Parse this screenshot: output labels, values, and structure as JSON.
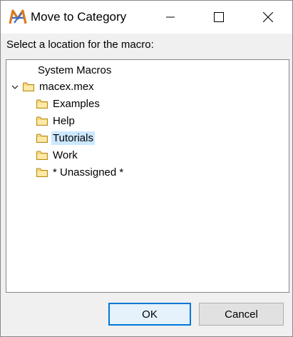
{
  "window": {
    "title": "Move to Category",
    "app_icon": "macro-express-icon"
  },
  "prompt": "Select a location for the macro:",
  "tree": {
    "items": [
      {
        "label": "System Macros",
        "level": 0,
        "icon": "none",
        "selected": false
      },
      {
        "label": "macex.mex",
        "level": 0,
        "icon": "folder-icon",
        "expanded": true,
        "selected": false
      },
      {
        "label": "Examples",
        "level": 1,
        "icon": "folder-icon",
        "selected": false
      },
      {
        "label": "Help",
        "level": 1,
        "icon": "folder-icon",
        "selected": false
      },
      {
        "label": "Tutorials",
        "level": 1,
        "icon": "folder-icon",
        "selected": true
      },
      {
        "label": "Work",
        "level": 1,
        "icon": "folder-icon",
        "selected": false
      },
      {
        "label": "* Unassigned *",
        "level": 1,
        "icon": "folder-icon",
        "selected": false
      }
    ]
  },
  "buttons": {
    "ok": "OK",
    "cancel": "Cancel"
  },
  "colors": {
    "selection": "#cce8ff",
    "default_button_border": "#0078d7",
    "folder_fill": "#f8d775"
  }
}
